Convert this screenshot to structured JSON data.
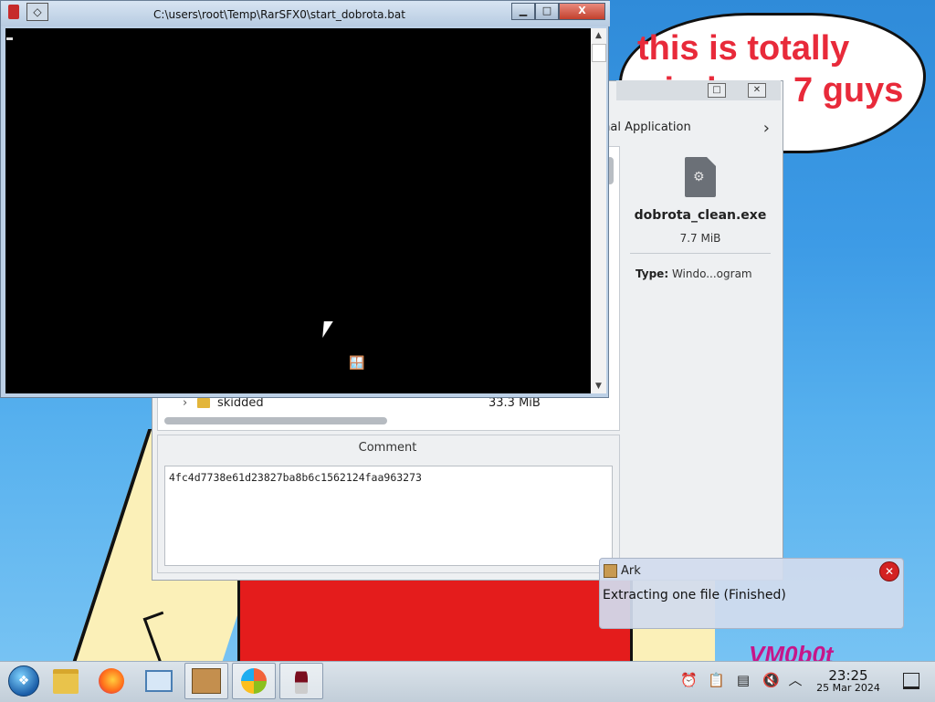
{
  "wallpaper": {
    "speech_bubble": "this is totally windows 7 guys",
    "watermark": "VM0b0t"
  },
  "ark_window": {
    "breadcrumb": "rnal Application",
    "file": {
      "name": "dobrota_clean.exe",
      "size": "7.7 MiB",
      "type_label": "Type:",
      "type_value": "Windo...ogram"
    },
    "list_row": {
      "name": "skidded",
      "size": "33.3 MiB"
    },
    "comment_label": "Comment",
    "comment_text": "4fc4d7738e61d23827ba8b6c1562124faa963273"
  },
  "cmd_window": {
    "title": "C:\\users\\root\\Temp\\RarSFX0\\start_dobrota.bat"
  },
  "notification": {
    "app": "Ark",
    "message": "Extracting one file (Finished)"
  },
  "taskbar": {
    "items": [
      "start-orb",
      "file-manager-icon",
      "firefox-icon",
      "remote-desktop-icon",
      "ark-icon",
      "windows-icon",
      "wine-icon"
    ],
    "clock_time": "23:25",
    "clock_date": "25 Mar 2024"
  }
}
